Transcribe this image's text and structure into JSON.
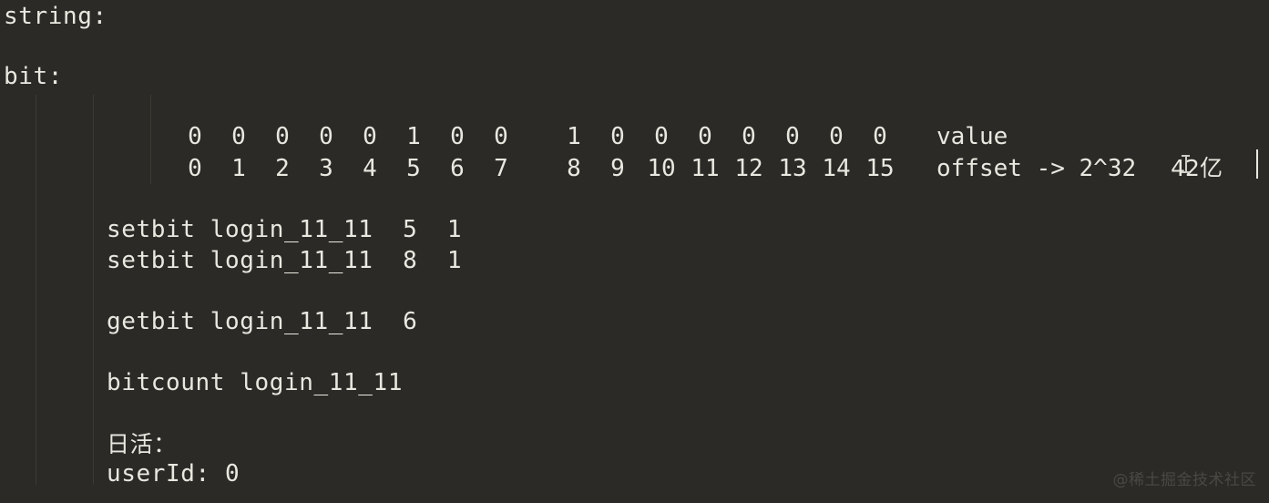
{
  "editor": {
    "background_color": "#2b2a26",
    "text_color": "#e9e8e0",
    "guide_color": "#3c3a35"
  },
  "headings": {
    "string_label": "string:",
    "bit_label": "bit:"
  },
  "bit_table": {
    "byte0": {
      "values": [
        "0",
        "0",
        "0",
        "0",
        "0",
        "1",
        "0",
        "0"
      ],
      "offsets": [
        "0",
        "1",
        "2",
        "3",
        "4",
        "5",
        "6",
        "7"
      ]
    },
    "byte1": {
      "values": [
        "1",
        "0",
        "0",
        "0",
        "0",
        "0",
        "0",
        "0"
      ],
      "offsets": [
        "8",
        "9",
        "10",
        "11",
        "12",
        "13",
        "14",
        "15"
      ]
    },
    "value_row_label": "value",
    "offset_row_label": "offset -> 2^32",
    "offset_annotation": "42亿"
  },
  "commands": {
    "setbit_1": "setbit login_11_11  5  1",
    "setbit_2": "setbit login_11_11  8  1",
    "getbit_1": "getbit login_11_11  6",
    "bitcount_1": "bitcount login_11_11"
  },
  "notes": {
    "daily_active_label": "日活：",
    "user_id_line": "userId: 0"
  },
  "watermark": {
    "text": "@稀土掘金技术社区"
  }
}
